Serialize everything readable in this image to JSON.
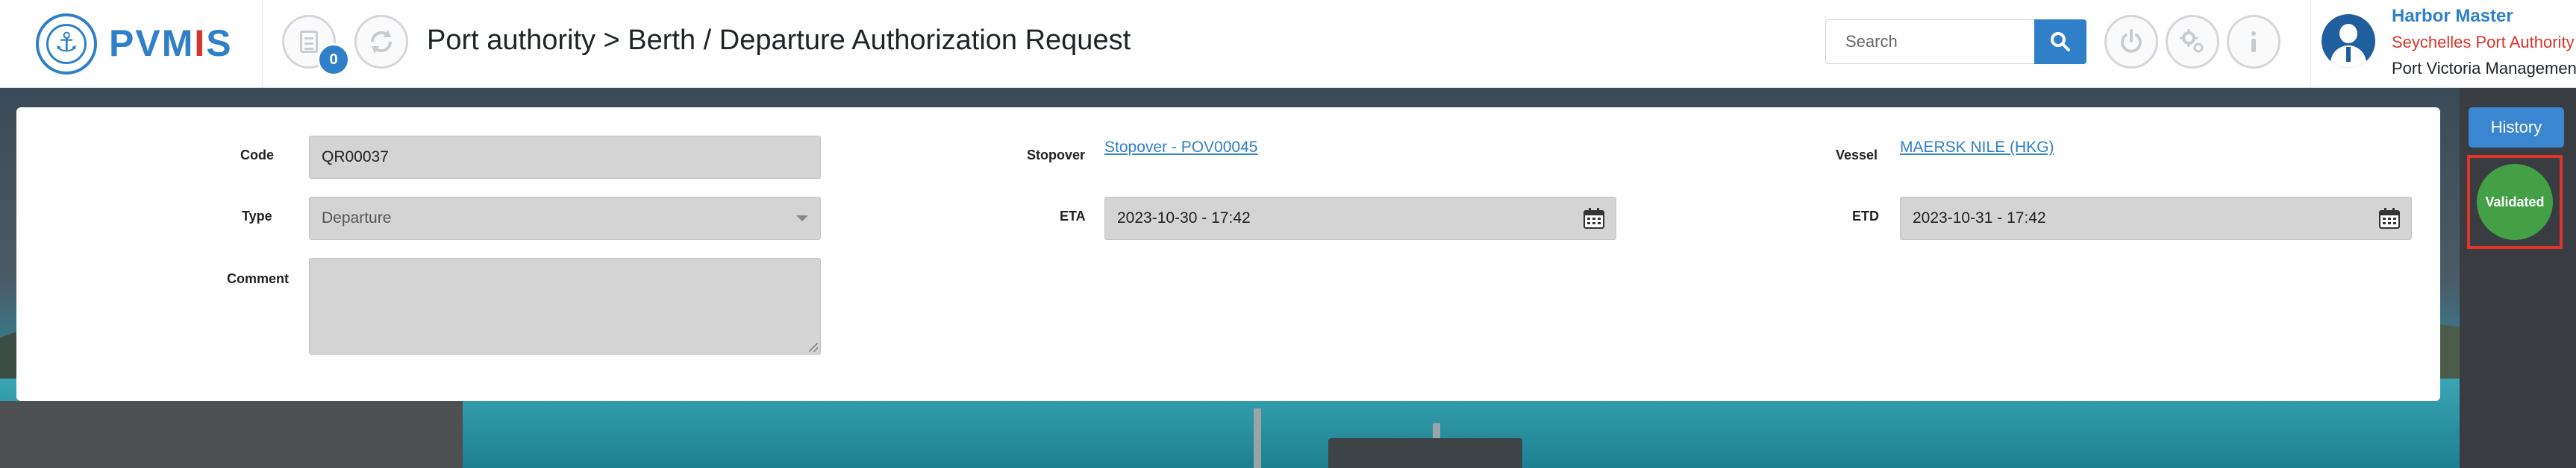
{
  "app": {
    "logo_text_a": "PVM",
    "logo_text_b": "I",
    "logo_text_c": "S"
  },
  "header": {
    "notification_count": "0",
    "title": "Port authority > Berth / Departure Authorization Request",
    "search_placeholder": "Search",
    "icons": [
      "document-icon",
      "refresh-icon",
      "search-icon",
      "power-icon",
      "settings-icon",
      "info-icon"
    ]
  },
  "user": {
    "name": "Harbor Master",
    "organization": "Seychelles Port Authority",
    "unit": "Port Victoria Management"
  },
  "form": {
    "code_label": "Code",
    "code_value": "QR00037",
    "type_label": "Type",
    "type_value": "Departure",
    "comment_label": "Comment",
    "comment_value": "",
    "stopover_label": "Stopover",
    "stopover_value": "Stopover - POV00045",
    "eta_label": "ETA",
    "eta_value": "2023-10-30 - 17:42",
    "vessel_label": "Vessel",
    "vessel_value": "MAERSK NILE (HKG)",
    "etd_label": "ETD",
    "etd_value": "2023-10-31 - 17:42"
  },
  "side": {
    "history_label": "History",
    "status": "Validated"
  },
  "colors": {
    "brand": "#2f80c9",
    "accent_red": "#d9342b",
    "status_green": "#43a047",
    "highlight_border": "#e0342b"
  }
}
